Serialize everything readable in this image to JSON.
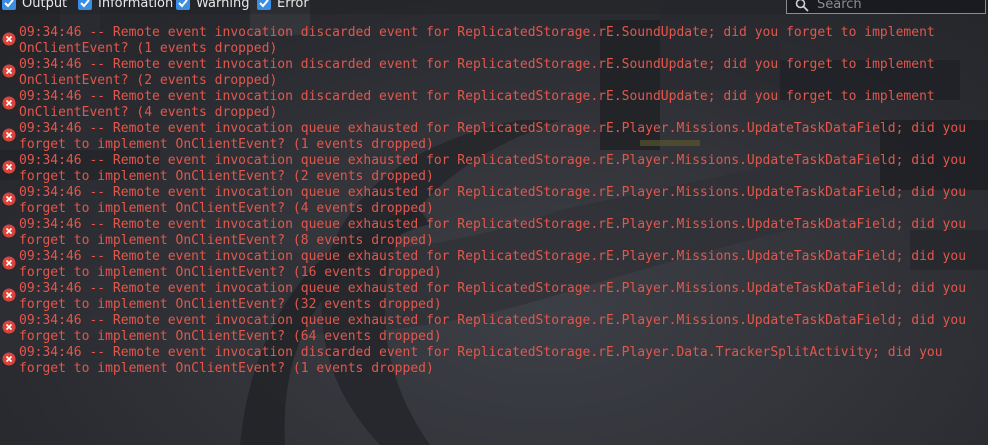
{
  "filters": [
    {
      "label": "Output",
      "checked": true
    },
    {
      "label": "Information",
      "checked": true
    },
    {
      "label": "Warning",
      "checked": true
    },
    {
      "label": "Error",
      "checked": true
    }
  ],
  "search": {
    "placeholder": "Search",
    "icon": "magnifier-icon"
  },
  "colors": {
    "error_text": "#e2574c",
    "checkbox": "#3a8de0"
  },
  "log": [
    {
      "level": "error",
      "line1": "09:34:46 -- Remote event invocation discarded event for ReplicatedStorage.rE.SoundUpdate; did you forget to implement",
      "line2": "OnClientEvent? (1 events dropped)"
    },
    {
      "level": "error",
      "line1": "09:34:46 -- Remote event invocation discarded event for ReplicatedStorage.rE.SoundUpdate; did you forget to implement",
      "line2": "OnClientEvent? (2 events dropped)"
    },
    {
      "level": "error",
      "line1": "09:34:46 -- Remote event invocation discarded event for ReplicatedStorage.rE.SoundUpdate; did you forget to implement",
      "line2": "OnClientEvent? (4 events dropped)"
    },
    {
      "level": "error",
      "line1": "09:34:46 -- Remote event invocation queue exhausted for ReplicatedStorage.rE.Player.Missions.UpdateTaskDataField; did you",
      "line2": "forget to implement OnClientEvent? (1 events dropped)"
    },
    {
      "level": "error",
      "line1": "09:34:46 -- Remote event invocation queue exhausted for ReplicatedStorage.rE.Player.Missions.UpdateTaskDataField; did you",
      "line2": "forget to implement OnClientEvent? (2 events dropped)"
    },
    {
      "level": "error",
      "line1": "09:34:46 -- Remote event invocation queue exhausted for ReplicatedStorage.rE.Player.Missions.UpdateTaskDataField; did you",
      "line2": "forget to implement OnClientEvent? (4 events dropped)"
    },
    {
      "level": "error",
      "line1": "09:34:46 -- Remote event invocation queue exhausted for ReplicatedStorage.rE.Player.Missions.UpdateTaskDataField; did you",
      "line2": "forget to implement OnClientEvent? (8 events dropped)"
    },
    {
      "level": "error",
      "line1": "09:34:46 -- Remote event invocation queue exhausted for ReplicatedStorage.rE.Player.Missions.UpdateTaskDataField; did you",
      "line2": "forget to implement OnClientEvent? (16 events dropped)"
    },
    {
      "level": "error",
      "line1": "09:34:46 -- Remote event invocation queue exhausted for ReplicatedStorage.rE.Player.Missions.UpdateTaskDataField; did you",
      "line2": "forget to implement OnClientEvent? (32 events dropped)"
    },
    {
      "level": "error",
      "line1": "09:34:46 -- Remote event invocation queue exhausted for ReplicatedStorage.rE.Player.Missions.UpdateTaskDataField; did you",
      "line2": "forget to implement OnClientEvent? (64 events dropped)"
    },
    {
      "level": "error",
      "line1": "09:34:46 -- Remote event invocation discarded event for ReplicatedStorage.rE.Player.Data.TrackerSplitActivity; did you",
      "line2": "forget to implement OnClientEvent? (1 events dropped)"
    }
  ]
}
